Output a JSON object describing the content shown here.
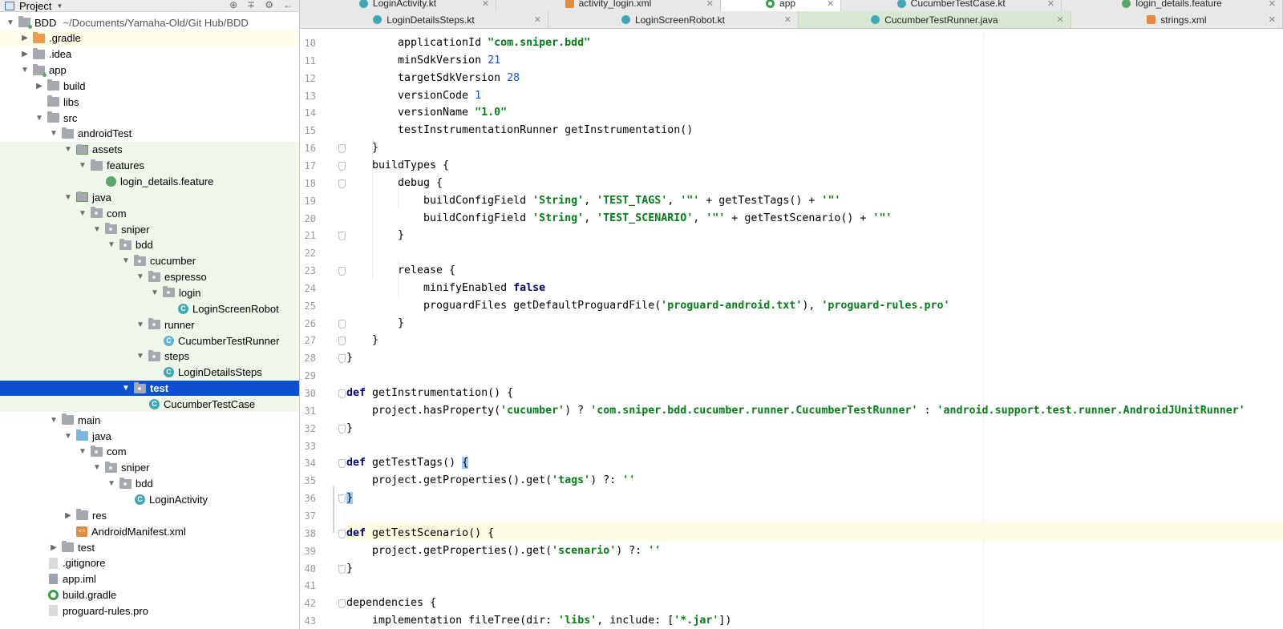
{
  "project_panel": {
    "title": "Project",
    "tools": [
      "⊕",
      "∓",
      "⚙",
      "←"
    ],
    "tree": [
      {
        "label": "BDD",
        "sub": "~/Documents/Yamaha-Old/Git Hub/BDD",
        "depth": 0,
        "arrow": "▼",
        "icon": "module-folder",
        "scope": "root"
      },
      {
        "label": ".gradle",
        "depth": 1,
        "arrow": "▶",
        "icon": "folder-orange",
        "scope": "root"
      },
      {
        "label": ".idea",
        "depth": 1,
        "arrow": "▶",
        "icon": "folder",
        "scope": ""
      },
      {
        "label": "app",
        "depth": 1,
        "arrow": "▼",
        "icon": "module-folder",
        "scope": ""
      },
      {
        "label": "build",
        "depth": 2,
        "arrow": "▶",
        "icon": "folder",
        "scope": ""
      },
      {
        "label": "libs",
        "depth": 2,
        "arrow": "",
        "icon": "folder",
        "scope": ""
      },
      {
        "label": "src",
        "depth": 2,
        "arrow": "▼",
        "icon": "folder",
        "scope": ""
      },
      {
        "label": "androidTest",
        "depth": 3,
        "arrow": "▼",
        "icon": "folder",
        "scope": ""
      },
      {
        "label": "assets",
        "depth": 4,
        "arrow": "▼",
        "icon": "folder-green",
        "scope": "test"
      },
      {
        "label": "features",
        "depth": 5,
        "arrow": "▼",
        "icon": "folder",
        "scope": "test"
      },
      {
        "label": "login_details.feature",
        "depth": 6,
        "arrow": "",
        "icon": "feature",
        "scope": "test"
      },
      {
        "label": "java",
        "depth": 4,
        "arrow": "▼",
        "icon": "folder-green",
        "scope": "test"
      },
      {
        "label": "com",
        "depth": 5,
        "arrow": "▼",
        "icon": "package",
        "scope": "test"
      },
      {
        "label": "sniper",
        "depth": 6,
        "arrow": "▼",
        "icon": "package",
        "scope": "test"
      },
      {
        "label": "bdd",
        "depth": 7,
        "arrow": "▼",
        "icon": "package",
        "scope": "test"
      },
      {
        "label": "cucumber",
        "depth": 8,
        "arrow": "▼",
        "icon": "package",
        "scope": "test"
      },
      {
        "label": "espresso",
        "depth": 9,
        "arrow": "▼",
        "icon": "package",
        "scope": "test"
      },
      {
        "label": "login",
        "depth": 10,
        "arrow": "▼",
        "icon": "package",
        "scope": "test"
      },
      {
        "label": "LoginScreenRobot",
        "depth": 11,
        "arrow": "",
        "icon": "kotlin-class",
        "scope": "test"
      },
      {
        "label": "runner",
        "depth": 9,
        "arrow": "▼",
        "icon": "package",
        "scope": "test"
      },
      {
        "label": "CucumberTestRunner",
        "depth": 10,
        "arrow": "",
        "icon": "java-class",
        "scope": "test"
      },
      {
        "label": "steps",
        "depth": 9,
        "arrow": "▼",
        "icon": "package",
        "scope": "test"
      },
      {
        "label": "LoginDetailsSteps",
        "depth": 10,
        "arrow": "",
        "icon": "kotlin-class",
        "scope": "test"
      },
      {
        "label": "test",
        "depth": 8,
        "arrow": "▼",
        "icon": "package",
        "scope": "selected"
      },
      {
        "label": "CucumberTestCase",
        "depth": 9,
        "arrow": "",
        "icon": "kotlin-class",
        "scope": "test"
      },
      {
        "label": "main",
        "depth": 3,
        "arrow": "▼",
        "icon": "folder",
        "scope": ""
      },
      {
        "label": "java",
        "depth": 4,
        "arrow": "▼",
        "icon": "folder-blue",
        "scope": ""
      },
      {
        "label": "com",
        "depth": 5,
        "arrow": "▼",
        "icon": "package",
        "scope": ""
      },
      {
        "label": "sniper",
        "depth": 6,
        "arrow": "▼",
        "icon": "package",
        "scope": ""
      },
      {
        "label": "bdd",
        "depth": 7,
        "arrow": "▼",
        "icon": "package",
        "scope": ""
      },
      {
        "label": "LoginActivity",
        "depth": 8,
        "arrow": "",
        "icon": "kotlin-class",
        "scope": ""
      },
      {
        "label": "res",
        "depth": 4,
        "arrow": "▶",
        "icon": "folder",
        "scope": ""
      },
      {
        "label": "AndroidManifest.xml",
        "depth": 4,
        "arrow": "",
        "icon": "xml",
        "scope": ""
      },
      {
        "label": "test",
        "depth": 3,
        "arrow": "▶",
        "icon": "folder",
        "scope": ""
      },
      {
        "label": ".gitignore",
        "depth": 2,
        "arrow": "",
        "icon": "file",
        "scope": ""
      },
      {
        "label": "app.iml",
        "depth": 2,
        "arrow": "",
        "icon": "iml",
        "scope": ""
      },
      {
        "label": "build.gradle",
        "depth": 2,
        "arrow": "",
        "icon": "gradle",
        "scope": ""
      },
      {
        "label": "proguard-rules.pro",
        "depth": 2,
        "arrow": "",
        "icon": "file",
        "scope": ""
      }
    ]
  },
  "tabs_row1": [
    {
      "label": "LoginActivity.kt",
      "icon": "kotlin",
      "width": 245,
      "active": false
    },
    {
      "label": "activity_login.xml",
      "icon": "xml",
      "width": 280,
      "active": false
    },
    {
      "label": "app",
      "icon": "gradle",
      "width": 150,
      "active": true
    },
    {
      "label": "CucumberTestCase.kt",
      "icon": "kotlin",
      "width": 275,
      "active": false
    },
    {
      "label": "login_details.feature",
      "icon": "feature",
      "width": 276,
      "active": false
    }
  ],
  "tabs_row2": [
    {
      "label": "LoginDetailsSteps.kt",
      "icon": "kotlin",
      "width": 310,
      "active": false
    },
    {
      "label": "LoginScreenRobot.kt",
      "icon": "kotlin",
      "width": 312,
      "active": false
    },
    {
      "label": "CucumberTestRunner.java",
      "icon": "java",
      "width": 340,
      "active": true
    },
    {
      "label": "strings.xml",
      "icon": "xml",
      "width": 264,
      "active": false
    }
  ],
  "code_lines": [
    {
      "n": "10",
      "indent": 2,
      "html": "applicationId <span class=\"str\">\"com.sniper.bdd\"</span>"
    },
    {
      "n": "11",
      "indent": 2,
      "html": "minSdkVersion <span class=\"num\">21</span>"
    },
    {
      "n": "12",
      "indent": 2,
      "html": "targetSdkVersion <span class=\"num\">28</span>"
    },
    {
      "n": "13",
      "indent": 2,
      "html": "versionCode <span class=\"num\">1</span>"
    },
    {
      "n": "14",
      "indent": 2,
      "html": "versionName <span class=\"str\">\"1.0\"</span>"
    },
    {
      "n": "15",
      "indent": 2,
      "html": "testInstrumentationRunner getInstrumentation()"
    },
    {
      "n": "16",
      "indent": 1,
      "html": "}",
      "fold": true
    },
    {
      "n": "17",
      "indent": 1,
      "html": "buildTypes {",
      "fold": true
    },
    {
      "n": "18",
      "indent": 2,
      "html": "debug {",
      "fold": true
    },
    {
      "n": "19",
      "indent": 3,
      "html": "buildConfigField <span class=\"str\">'String'</span>, <span class=\"str\">'TEST_TAGS'</span>, <span class=\"str\">'\"'</span> + getTestTags() + <span class=\"str\">'\"'</span>"
    },
    {
      "n": "20",
      "indent": 3,
      "html": "buildConfigField <span class=\"str\">'String'</span>, <span class=\"str\">'TEST_SCENARIO'</span>, <span class=\"str\">'\"'</span> + getTestScenario() + <span class=\"str\">'\"'</span>"
    },
    {
      "n": "21",
      "indent": 2,
      "html": "}",
      "fold": true
    },
    {
      "n": "22",
      "indent": 0,
      "html": ""
    },
    {
      "n": "23",
      "indent": 2,
      "html": "release {",
      "fold": true
    },
    {
      "n": "24",
      "indent": 3,
      "html": "minifyEnabled <span class=\"kw\">false</span>"
    },
    {
      "n": "25",
      "indent": 3,
      "html": "proguardFiles getDefaultProguardFile(<span class=\"str\">'proguard-android.txt'</span>), <span class=\"str\">'proguard-rules.pro'</span>"
    },
    {
      "n": "26",
      "indent": 2,
      "html": "}",
      "fold": true
    },
    {
      "n": "27",
      "indent": 1,
      "html": "}",
      "fold": true
    },
    {
      "n": "28",
      "indent": 0,
      "html": "}",
      "fold": true
    },
    {
      "n": "29",
      "indent": 0,
      "html": ""
    },
    {
      "n": "30",
      "indent": 0,
      "html": "<span class=\"kw\">def</span> getInstrumentation() {",
      "fold": true
    },
    {
      "n": "31",
      "indent": 1,
      "html": "project.hasProperty(<span class=\"str\">'cucumber'</span>) ? <span class=\"str\">'com.sniper.bdd.cucumber.runner.CucumberTestRunner'</span> : <span class=\"str\">'android.support.test.runner.AndroidJUnitRunner'</span>"
    },
    {
      "n": "32",
      "indent": 0,
      "html": "}",
      "fold": true
    },
    {
      "n": "33",
      "indent": 0,
      "html": ""
    },
    {
      "n": "34",
      "indent": 0,
      "html": "<span class=\"kw\">def</span> getTestTags() <span class=\"brace-hl\">{</span>",
      "fold": true
    },
    {
      "n": "35",
      "indent": 1,
      "html": "project.getProperties().get(<span class=\"str\">'tags'</span>) ?: <span class=\"str\">''</span>"
    },
    {
      "n": "36",
      "indent": 0,
      "html": "<span class=\"brace-hl\">}</span>",
      "fold": true
    },
    {
      "n": "37",
      "indent": 0,
      "html": ""
    },
    {
      "n": "38",
      "indent": 0,
      "html": "<span class=\"kw\">def</span> getTestScenario() {",
      "fold": true
    },
    {
      "n": "39",
      "indent": 1,
      "html": "project.getProperties().get(<span class=\"str\">'scenario'</span>) ?: <span class=\"str\">''</span>"
    },
    {
      "n": "40",
      "indent": 0,
      "html": "}",
      "fold": true
    },
    {
      "n": "41",
      "indent": 0,
      "html": ""
    },
    {
      "n": "42",
      "indent": 0,
      "html": "dependencies {",
      "fold": true
    },
    {
      "n": "43",
      "indent": 1,
      "html": "implementation fileTree(dir: <span class=\"str\">'libs'</span>, include: [<span class=\"str\">'*.jar'</span>])"
    }
  ]
}
